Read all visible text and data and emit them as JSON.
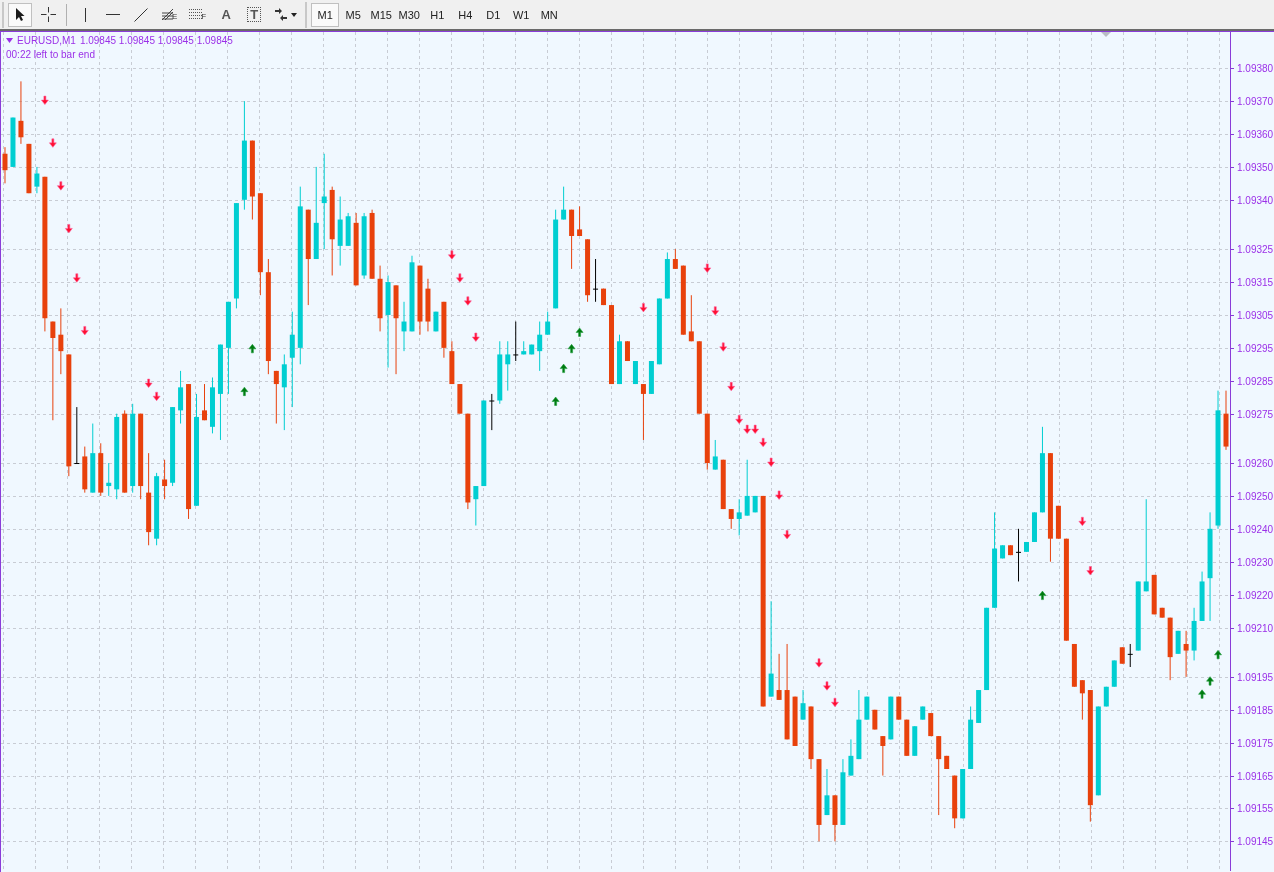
{
  "toolbar": {
    "tools": [
      {
        "kind": "select",
        "selected": true
      },
      {
        "kind": "crosshair",
        "selected": false
      },
      {
        "kind": "vline",
        "selected": false
      },
      {
        "kind": "hline",
        "selected": false
      },
      {
        "kind": "trendline",
        "selected": false
      },
      {
        "kind": "fibo",
        "glyph": "E",
        "selected": false
      },
      {
        "kind": "fibogrid",
        "glyph": "F",
        "selected": false
      },
      {
        "kind": "text",
        "glyph": "A",
        "selected": false
      },
      {
        "kind": "label",
        "glyph": "T",
        "selected": false
      },
      {
        "kind": "arrows",
        "selected": false
      }
    ],
    "timeframes": [
      {
        "label": "M1",
        "selected": true
      },
      {
        "label": "M5",
        "selected": false
      },
      {
        "label": "M15",
        "selected": false
      },
      {
        "label": "M30",
        "selected": false
      },
      {
        "label": "H1",
        "selected": false
      },
      {
        "label": "H4",
        "selected": false
      },
      {
        "label": "D1",
        "selected": false
      },
      {
        "label": "W1",
        "selected": false
      },
      {
        "label": "MN",
        "selected": false
      }
    ]
  },
  "chart": {
    "header": {
      "symbol": "EURUSD,M1",
      "quotes": "1.09845 1.09845 1.09845 1.09845",
      "countdown": "00:22 left to bar end"
    },
    "chart_data": {
      "type": "candlestick",
      "grid": true,
      "ylim": [
        1.09136,
        1.09391
      ],
      "yticks": [
        {
          "value": 1.0938,
          "label": "1.09380"
        },
        {
          "value": 1.0937,
          "label": "1.09370"
        },
        {
          "value": 1.0936,
          "label": "1.09360"
        },
        {
          "value": 1.0935,
          "label": "1.09350"
        },
        {
          "value": 1.0934,
          "label": "1.09340"
        },
        {
          "value": 1.09325,
          "label": "1.09325"
        },
        {
          "value": 1.09315,
          "label": "1.09315"
        },
        {
          "value": 1.09305,
          "label": "1.09305"
        },
        {
          "value": 1.09295,
          "label": "1.09295"
        },
        {
          "value": 1.09285,
          "label": "1.09285"
        },
        {
          "value": 1.09275,
          "label": "1.09275"
        },
        {
          "value": 1.0926,
          "label": "1.09260"
        },
        {
          "value": 1.0925,
          "label": "1.09250"
        },
        {
          "value": 1.0924,
          "label": "1.09240"
        },
        {
          "value": 1.0923,
          "label": "1.09230"
        },
        {
          "value": 1.0922,
          "label": "1.09220"
        },
        {
          "value": 1.0921,
          "label": "1.09210"
        },
        {
          "value": 1.09195,
          "label": "1.09195"
        },
        {
          "value": 1.09185,
          "label": "1.09185"
        },
        {
          "value": 1.09175,
          "label": "1.09175"
        },
        {
          "value": 1.09165,
          "label": "1.09165"
        },
        {
          "value": 1.09155,
          "label": "1.09155"
        },
        {
          "value": 1.09145,
          "label": "1.09145"
        }
      ],
      "categories": [
        null,
        null,
        null,
        null,
        null,
        null,
        null,
        null,
        null,
        null,
        null,
        null,
        null,
        null,
        null,
        null,
        null,
        null,
        null,
        null,
        null,
        null,
        null,
        null,
        null,
        null,
        null,
        null,
        null,
        null,
        null,
        null,
        null,
        null,
        null,
        null,
        null,
        null,
        null,
        null,
        null,
        null,
        null,
        null,
        null,
        null,
        null,
        null,
        null,
        null,
        null,
        null,
        null,
        null,
        null,
        null,
        null,
        null,
        null,
        null,
        null,
        null,
        null,
        null,
        null,
        null,
        null,
        null,
        null,
        null,
        null,
        null,
        null,
        null,
        null,
        null,
        null,
        null,
        null,
        null,
        null,
        null,
        null,
        null,
        null,
        null,
        null,
        null,
        null,
        null,
        null,
        null,
        null,
        null,
        null,
        null,
        null,
        null,
        null,
        null,
        null,
        null,
        null,
        null,
        null,
        null,
        null,
        null,
        null,
        null,
        null,
        null,
        null,
        null,
        null,
        null,
        null,
        null,
        null,
        null,
        null,
        null,
        null,
        null,
        null,
        null,
        null,
        null,
        null,
        null,
        null,
        null,
        null,
        null,
        null,
        null,
        null,
        null,
        null,
        null,
        null,
        null,
        null,
        null,
        null,
        null,
        null,
        null,
        null,
        null,
        null,
        null,
        null,
        null
      ],
      "ohlc": [
        [
          1.09354,
          1.09356,
          1.09345,
          1.09349
        ],
        [
          1.0935,
          1.09365,
          1.0935,
          1.09365
        ],
        [
          1.09364,
          1.09376,
          1.09357,
          1.09359
        ],
        [
          1.09357,
          1.09357,
          1.09342,
          1.09342
        ],
        [
          1.09344,
          1.0935,
          1.09342,
          1.09348
        ],
        [
          1.09347,
          1.09347,
          1.093,
          1.09304
        ],
        [
          1.09303,
          1.09303,
          1.09273,
          1.09298
        ],
        [
          1.09299,
          1.09307,
          1.09287,
          1.09294
        ],
        [
          1.09293,
          1.09293,
          1.09256,
          1.09259
        ],
        [
          1.0926,
          1.09277,
          1.0926,
          1.0926
        ],
        [
          1.09262,
          1.09265,
          1.09251,
          1.09252
        ],
        [
          1.09251,
          1.09272,
          1.09251,
          1.09263
        ],
        [
          1.09263,
          1.09266,
          1.0925,
          1.09251
        ],
        [
          1.09253,
          1.0926,
          1.0925,
          1.09254
        ],
        [
          1.09252,
          1.09275,
          1.09249,
          1.09274
        ],
        [
          1.09275,
          1.09276,
          1.09251,
          1.09251
        ],
        [
          1.09253,
          1.09278,
          1.09251,
          1.09275
        ],
        [
          1.09275,
          1.09275,
          1.09249,
          1.09253
        ],
        [
          1.09251,
          1.09263,
          1.09235,
          1.09239
        ],
        [
          1.09237,
          1.09257,
          1.09235,
          1.09256
        ],
        [
          1.09255,
          1.09261,
          1.09249,
          1.09253
        ],
        [
          1.09254,
          1.09277,
          1.09253,
          1.09277
        ],
        [
          1.09276,
          1.09288,
          1.09272,
          1.09283
        ],
        [
          1.09284,
          1.09284,
          1.09243,
          1.09246
        ],
        [
          1.09247,
          1.09281,
          1.09247,
          1.09274
        ],
        [
          1.09276,
          1.09284,
          1.09273,
          1.09273
        ],
        [
          1.09271,
          1.09286,
          1.09269,
          1.09283
        ],
        [
          1.09281,
          1.09296,
          1.09267,
          1.09296
        ],
        [
          1.09295,
          1.09309,
          1.09281,
          1.09309
        ],
        [
          1.0931,
          1.09339,
          1.09307,
          1.09339
        ],
        [
          1.0934,
          1.0937,
          1.09337,
          1.09358
        ],
        [
          1.09358,
          1.09358,
          1.09334,
          1.09341
        ],
        [
          1.09342,
          1.09342,
          1.09311,
          1.09318
        ],
        [
          1.09318,
          1.09322,
          1.09287,
          1.09291
        ],
        [
          1.09288,
          1.09288,
          1.09272,
          1.09284
        ],
        [
          1.09283,
          1.09293,
          1.0927,
          1.0929
        ],
        [
          1.09292,
          1.09306,
          1.09277,
          1.09299
        ],
        [
          1.09295,
          1.09344,
          1.0929,
          1.09338
        ],
        [
          1.09337,
          1.09337,
          1.09308,
          1.09322
        ],
        [
          1.09322,
          1.0935,
          1.09322,
          1.09333
        ],
        [
          1.09339,
          1.09354,
          1.09325,
          1.09341
        ],
        [
          1.09343,
          1.09344,
          1.09317,
          1.09328
        ],
        [
          1.09326,
          1.09341,
          1.0932,
          1.09334
        ],
        [
          1.09326,
          1.09336,
          1.09326,
          1.09335
        ],
        [
          1.09333,
          1.09336,
          1.09314,
          1.09314
        ],
        [
          1.09317,
          1.09336,
          1.09316,
          1.09335
        ],
        [
          1.09336,
          1.09337,
          1.09316,
          1.09316
        ],
        [
          1.09316,
          1.0932,
          1.093,
          1.09304
        ],
        [
          1.09305,
          1.09317,
          1.09289,
          1.09315
        ],
        [
          1.09314,
          1.09314,
          1.09287,
          1.09304
        ],
        [
          1.093,
          1.09309,
          1.09294,
          1.09303
        ],
        [
          1.093,
          1.09323,
          1.093,
          1.09321
        ],
        [
          1.0932,
          1.0932,
          1.09299,
          1.09303
        ],
        [
          1.09313,
          1.09316,
          1.093,
          1.09303
        ],
        [
          1.093,
          1.09306,
          1.093,
          1.09306
        ],
        [
          1.09309,
          1.09309,
          1.09292,
          1.09295
        ],
        [
          1.09294,
          1.09297,
          1.09284,
          1.09284
        ],
        [
          1.09284,
          1.09284,
          1.09275,
          1.09275
        ],
        [
          1.09275,
          1.09275,
          1.09246,
          1.09248
        ],
        [
          1.09249,
          1.09253,
          1.09241,
          1.09253
        ],
        [
          1.09253,
          1.09279,
          1.09253,
          1.09279
        ],
        [
          1.09279,
          1.09281,
          1.0927,
          1.09279
        ],
        [
          1.09279,
          1.09297,
          1.09278,
          1.09293
        ],
        [
          1.0929,
          1.09297,
          1.09282,
          1.09293
        ],
        [
          1.09293,
          1.09303,
          1.09291,
          1.09293
        ],
        [
          1.09293,
          1.09297,
          1.09293,
          1.09294
        ],
        [
          1.09293,
          1.09296,
          1.09293,
          1.09296
        ],
        [
          1.09294,
          1.09303,
          1.09288,
          1.09299
        ],
        [
          1.09299,
          1.09306,
          1.09299,
          1.09303
        ],
        [
          1.09307,
          1.09337,
          1.09307,
          1.09334
        ],
        [
          1.09334,
          1.09344,
          1.09334,
          1.09337
        ],
        [
          1.09337,
          1.09337,
          1.09319,
          1.09329
        ],
        [
          1.09331,
          1.09338,
          1.09329,
          1.09329
        ],
        [
          1.09328,
          1.09328,
          1.09309,
          1.09311
        ],
        [
          1.09313,
          1.09322,
          1.09309,
          1.09313
        ],
        [
          1.09313,
          1.09313,
          1.09308,
          1.09308
        ],
        [
          1.09308,
          1.09308,
          1.09284,
          1.09284
        ],
        [
          1.09284,
          1.09299,
          1.09284,
          1.09297
        ],
        [
          1.09297,
          1.09297,
          1.09291,
          1.09291
        ],
        [
          1.09284,
          1.09291,
          1.09284,
          1.09291
        ],
        [
          1.09284,
          1.09284,
          1.09267,
          1.09281
        ],
        [
          1.09281,
          1.09291,
          1.09281,
          1.09291
        ],
        [
          1.0929,
          1.0931,
          1.0929,
          1.0931
        ],
        [
          1.0931,
          1.09324,
          1.0931,
          1.09322
        ],
        [
          1.09322,
          1.09325,
          1.09319,
          1.09319
        ],
        [
          1.0932,
          1.0932,
          1.09299,
          1.09299
        ],
        [
          1.093,
          1.09311,
          1.09297,
          1.09297
        ],
        [
          1.09297,
          1.09297,
          1.09275,
          1.09275
        ],
        [
          1.09275,
          1.09275,
          1.09258,
          1.0926
        ],
        [
          1.09258,
          1.09267,
          1.09258,
          1.09262
        ],
        [
          1.09261,
          1.09261,
          1.09246,
          1.09246
        ],
        [
          1.09246,
          1.09246,
          1.0924,
          1.09243
        ],
        [
          1.09243,
          1.09249,
          1.09238,
          1.09245
        ],
        [
          1.09244,
          1.09261,
          1.09244,
          1.0925
        ],
        [
          1.09245,
          1.0925,
          1.09245,
          1.0925
        ],
        [
          1.0925,
          1.0925,
          1.09186,
          1.09186
        ],
        [
          1.09189,
          1.09218,
          1.09189,
          1.09196
        ],
        [
          1.09191,
          1.09202,
          1.09188,
          1.09188
        ],
        [
          1.09191,
          1.09205,
          1.09176,
          1.09176
        ],
        [
          1.09189,
          1.09189,
          1.09174,
          1.09174
        ],
        [
          1.09182,
          1.09191,
          1.09182,
          1.09187
        ],
        [
          1.09186,
          1.09186,
          1.09167,
          1.0917
        ],
        [
          1.0917,
          1.0917,
          1.09145,
          1.0915
        ],
        [
          1.09153,
          1.09167,
          1.09153,
          1.09159
        ],
        [
          1.09159,
          1.09159,
          1.09145,
          1.0915
        ],
        [
          1.0915,
          1.0917,
          1.0915,
          1.09166
        ],
        [
          1.09165,
          1.09176,
          1.09165,
          1.09171
        ],
        [
          1.0917,
          1.09191,
          1.0917,
          1.09182
        ],
        [
          1.09182,
          1.09189,
          1.09182,
          1.09189
        ],
        [
          1.09185,
          1.09185,
          1.09179,
          1.09179
        ],
        [
          1.09177,
          1.09177,
          1.09165,
          1.09174
        ],
        [
          1.09176,
          1.09189,
          1.09176,
          1.09189
        ],
        [
          1.09189,
          1.09189,
          1.09182,
          1.09182
        ],
        [
          1.09182,
          1.09182,
          1.09171,
          1.09171
        ],
        [
          1.09171,
          1.0918,
          1.09171,
          1.0918
        ],
        [
          1.09182,
          1.09186,
          1.09182,
          1.09186
        ],
        [
          1.09184,
          1.09184,
          1.09177,
          1.09177
        ],
        [
          1.09177,
          1.09177,
          1.09153,
          1.0917
        ],
        [
          1.09171,
          1.09171,
          1.09167,
          1.09167
        ],
        [
          1.09165,
          1.09165,
          1.09149,
          1.09152
        ],
        [
          1.09152,
          1.09167,
          1.09152,
          1.09167
        ],
        [
          1.09167,
          1.09186,
          1.09167,
          1.09182
        ],
        [
          1.09181,
          1.09191,
          1.09181,
          1.09191
        ],
        [
          1.09191,
          1.09216,
          1.09191,
          1.09216
        ],
        [
          1.09216,
          1.09245,
          1.09216,
          1.09234
        ],
        [
          1.09231,
          1.09235,
          1.09231,
          1.09235
        ],
        [
          1.09235,
          1.09235,
          1.09232,
          1.09232
        ],
        [
          1.09233,
          1.0924,
          1.09224,
          1.09233
        ],
        [
          1.09233,
          1.09236,
          1.09233,
          1.09236
        ],
        [
          1.09236,
          1.09245,
          1.09236,
          1.09245
        ],
        [
          1.09245,
          1.09271,
          1.09245,
          1.09263
        ],
        [
          1.09263,
          1.09263,
          1.0923,
          1.09237
        ],
        [
          1.09247,
          1.09247,
          1.09237,
          1.09237
        ],
        [
          1.09237,
          1.09237,
          1.09206,
          1.09206
        ],
        [
          1.09205,
          1.09205,
          1.09192,
          1.09192
        ],
        [
          1.09194,
          1.09194,
          1.09182,
          1.0919
        ],
        [
          1.09191,
          1.09191,
          1.09151,
          1.09156
        ],
        [
          1.09159,
          1.09186,
          1.09159,
          1.09186
        ],
        [
          1.09186,
          1.09192,
          1.09186,
          1.09192
        ],
        [
          1.09192,
          1.092,
          1.09192,
          1.092
        ],
        [
          1.09204,
          1.09204,
          1.09199,
          1.09199
        ],
        [
          1.09202,
          1.09205,
          1.09198,
          1.09202
        ],
        [
          1.09203,
          1.09224,
          1.09203,
          1.09224
        ],
        [
          1.09221,
          1.09249,
          1.09221,
          1.09224
        ],
        [
          1.09226,
          1.09226,
          1.09214,
          1.09214
        ],
        [
          1.09216,
          1.09216,
          1.09213,
          1.09213
        ],
        [
          1.09213,
          1.09213,
          1.09194,
          1.09201
        ],
        [
          1.09202,
          1.09209,
          1.09202,
          1.09209
        ],
        [
          1.09205,
          1.09209,
          1.09195,
          1.09203
        ],
        [
          1.09203,
          1.09216,
          1.092,
          1.09212
        ],
        [
          1.09212,
          1.09227,
          1.09212,
          1.09224
        ],
        [
          1.09225,
          1.09245,
          1.09212,
          1.0924
        ],
        [
          1.09241,
          1.09282,
          1.0924,
          1.09276
        ],
        [
          1.09275,
          1.09282,
          1.09264,
          1.09265
        ]
      ]
    }
  }
}
